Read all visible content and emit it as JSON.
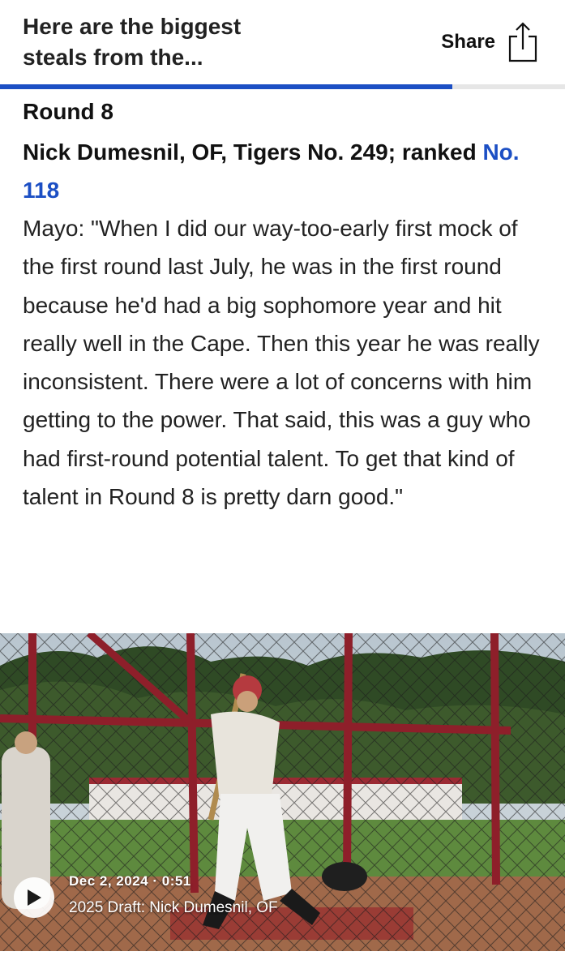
{
  "header": {
    "title": "Here are the biggest steals from the...",
    "share_label": "Share",
    "share_icon": "share-icon",
    "reading_progress_percent": 80
  },
  "article": {
    "round": "Round 8",
    "player_prefix": "Nick Dumesnil, OF, Tigers No. 249; ranked",
    "player_rank_link": "No. 118",
    "quote": "Mayo: \"When I did our way-too-early first mock of the first round last July, he was in the first round because he'd had a big sophomore year and hit really well in the Cape. Then this year he was really inconsistent. There were a lot of concerns with him getting to the power. That said, this was a guy who had first-round potential talent. To get that kind of talent in Round 8 is pretty darn good.\""
  },
  "video": {
    "date_duration": "Dec 2, 2024 · 0:51",
    "title": "2025 Draft: Nick Dumesnil, OF",
    "play_icon": "play-icon"
  },
  "colors": {
    "accent": "#1c4fc4",
    "progress_track": "#e6e6e6",
    "cage_frame": "#8e1f2a"
  }
}
